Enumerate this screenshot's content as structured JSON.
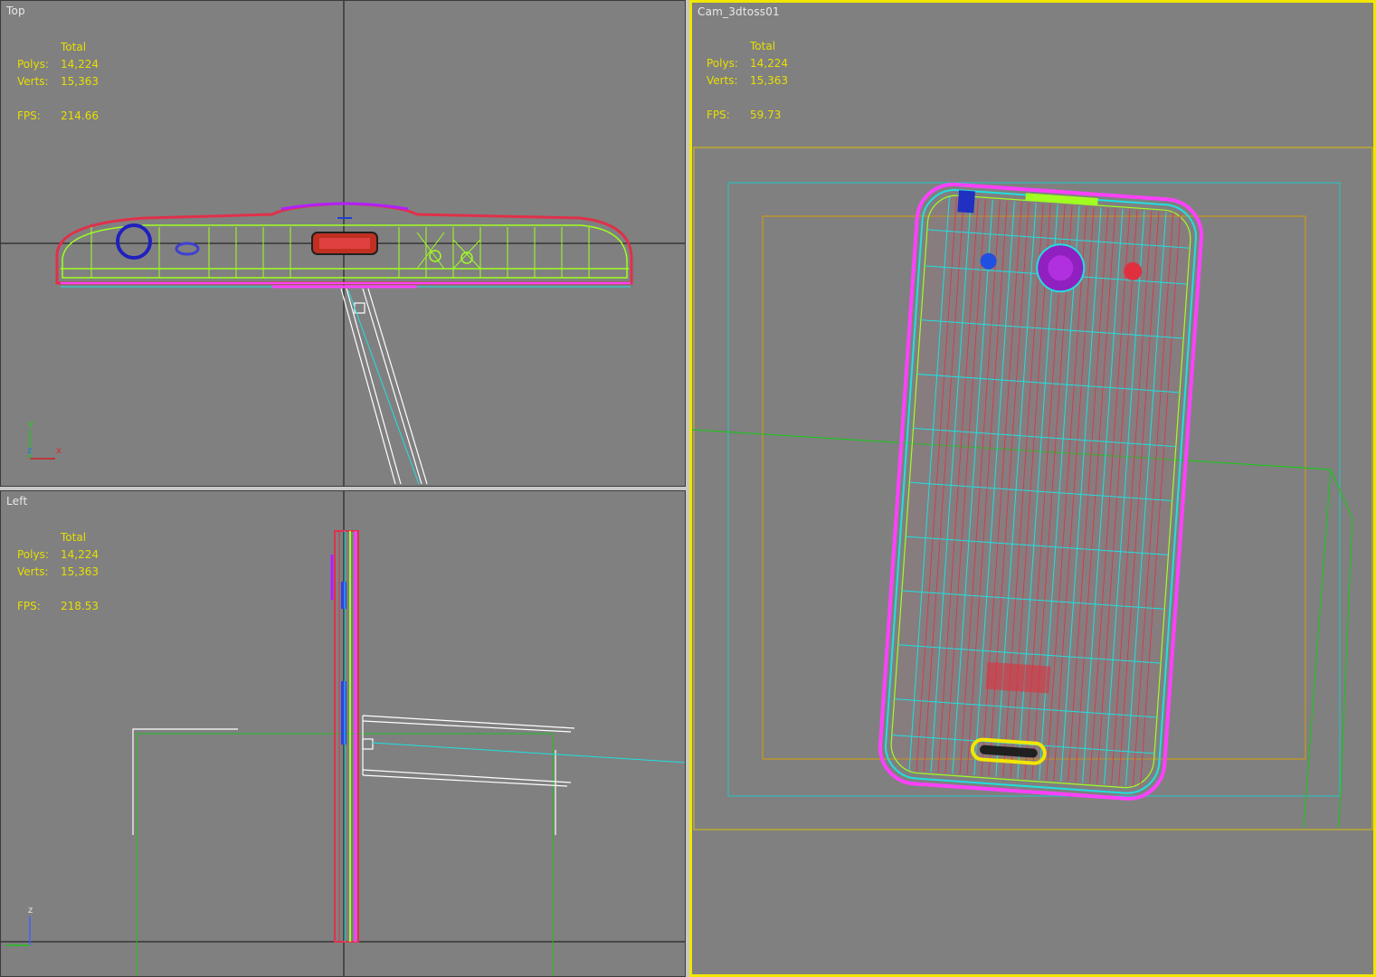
{
  "viewports": {
    "top": {
      "label": "Top",
      "stats": {
        "header": "Total",
        "polys_label": "Polys:",
        "polys": "14,224",
        "verts_label": "Verts:",
        "verts": "15,363",
        "fps_label": "FPS:",
        "fps": "214.66"
      },
      "axes": {
        "up": "y",
        "right": "x",
        "origin": "z"
      }
    },
    "left": {
      "label": "Left",
      "stats": {
        "header": "Total",
        "polys_label": "Polys:",
        "polys": "14,224",
        "verts_label": "Verts:",
        "verts": "15,363",
        "fps_label": "FPS:",
        "fps": "218.53"
      },
      "axes": {
        "up": "z"
      }
    },
    "camera": {
      "label": "Cam_3dtoss01",
      "stats": {
        "header": "Total",
        "polys_label": "Polys:",
        "polys": "14,224",
        "verts_label": "Verts:",
        "verts": "15,363",
        "fps_label": "FPS:",
        "fps": "59.73"
      },
      "active": true
    }
  },
  "colors": {
    "viewport_bg": "#808080",
    "active_border": "#f2e600",
    "stats_text": "#e8df00",
    "wire_red": "#e0304a",
    "wire_cyan": "#20e0e0",
    "wire_green": "#a0ff20",
    "wire_magenta": "#ff40ff",
    "wire_blue": "#2020c0",
    "grid_green": "#20c020",
    "safe_frame_orange": "#d8a000"
  }
}
